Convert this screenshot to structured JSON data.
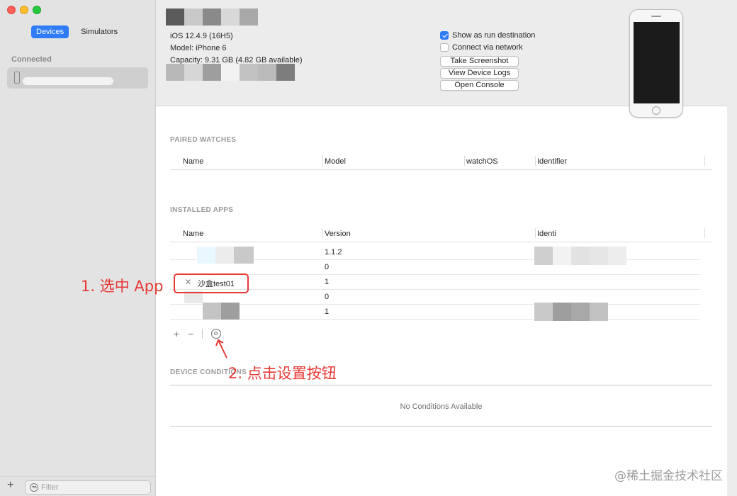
{
  "sidebar": {
    "tabs": [
      {
        "label": "Devices",
        "active": true
      },
      {
        "label": "Simulators",
        "active": false
      }
    ],
    "section_label": "Connected",
    "add_label": "+",
    "filter_placeholder": "Filter"
  },
  "device": {
    "ios": "iOS 12.4.9 (16H5)",
    "model": "Model: iPhone 6",
    "capacity": "Capacity: 9.31 GB (4.82 GB available)",
    "show_run_destination": {
      "label": "Show as run destination",
      "checked": true
    },
    "connect_network": {
      "label": "Connect via network",
      "checked": false
    },
    "buttons": {
      "screenshot": "Take Screenshot",
      "logs": "View Device Logs",
      "console": "Open Console"
    }
  },
  "paired_watches": {
    "title": "PAIRED WATCHES",
    "columns": [
      "Name",
      "Model",
      "watchOS",
      "Identifier"
    ]
  },
  "installed_apps": {
    "title": "INSTALLED APPS",
    "columns": [
      "Name",
      "Version",
      "Identi"
    ],
    "rows": [
      {
        "name": "",
        "version": "1.1.2"
      },
      {
        "name": "",
        "version": "0"
      },
      {
        "name": "沙盒test01",
        "version": "1"
      },
      {
        "name": "",
        "version": "0"
      },
      {
        "name": "",
        "version": "1"
      }
    ],
    "add": "+",
    "remove": "−"
  },
  "device_conditions": {
    "title": "DEVICE CONDITIONS",
    "empty": "No Conditions Available"
  },
  "annotations": {
    "step1": "1. 选中 App",
    "step2": "2. 点击设置按钮"
  },
  "watermark": "@稀土掘金技术社区",
  "colors": {
    "accent": "#2f7cf6",
    "annotation": "#e53935"
  }
}
